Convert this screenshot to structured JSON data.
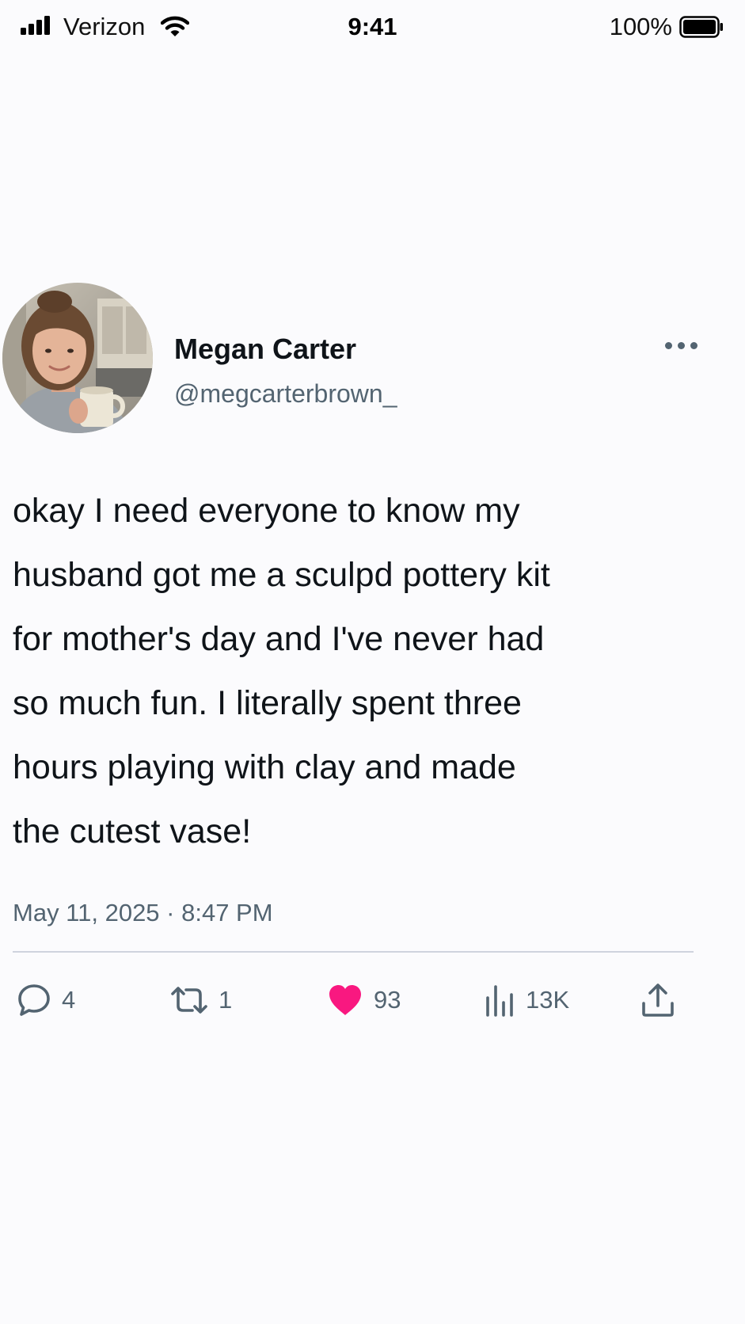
{
  "status_bar": {
    "carrier": "Verizon",
    "time": "9:41",
    "battery": "100%"
  },
  "tweet": {
    "author": {
      "display_name": "Megan Carter",
      "handle": "@megcarterbrown_"
    },
    "text": "okay I need everyone to know my\nhusband got me a sculpd pottery kit\nfor mother's day and I've never had\nso much fun. I literally spent three\nhours playing with clay and made\nthe cutest vase!",
    "timestamp": "May 11, 2025 · 8:47 PM",
    "actions": {
      "replies": "4",
      "reposts": "1",
      "likes": "93",
      "views": "13K"
    }
  },
  "colors": {
    "background": "#fbfbfd",
    "text_primary": "#0f1419",
    "text_secondary": "#536471",
    "like_active": "#f91880",
    "divider": "#cfd3de"
  },
  "icons": [
    "signal-icon",
    "wifi-icon",
    "battery-icon",
    "more-icon",
    "reply-icon",
    "repost-icon",
    "like-icon",
    "views-icon",
    "share-icon"
  ]
}
